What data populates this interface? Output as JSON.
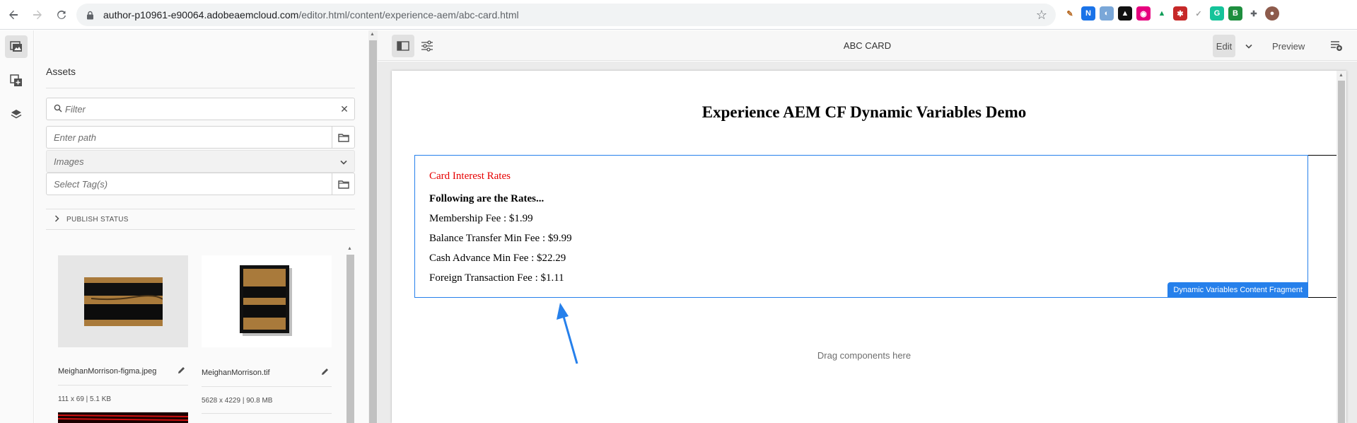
{
  "browser": {
    "url_host": "author-p10961-e90064.adobeaemcloud.com",
    "url_path": "/editor.html/content/experience-aem/abc-card.html",
    "extensions": [
      {
        "name": "pen-extension-icon",
        "bg": "#ffffff",
        "fg": "#b5651d",
        "glyph": "✎"
      },
      {
        "name": "n-extension-icon",
        "bg": "#1a73e8",
        "fg": "#ffffff",
        "glyph": "N"
      },
      {
        "name": "circle-extension-icon",
        "bg": "#7aa7d8",
        "fg": "#ffffff",
        "glyph": "◐"
      },
      {
        "name": "hat-extension-icon",
        "bg": "#111111",
        "fg": "#ffffff",
        "glyph": "▲"
      },
      {
        "name": "cbs-extension-icon",
        "bg": "#e6007e",
        "fg": "#ffffff",
        "glyph": "◉"
      },
      {
        "name": "drive-extension-icon",
        "bg": "#ffffff",
        "fg": "#0f9d58",
        "glyph": "▲"
      },
      {
        "name": "red-extension-icon",
        "bg": "#c62828",
        "fg": "#ffffff",
        "glyph": "✱"
      },
      {
        "name": "check-extension-icon",
        "bg": "#ffffff",
        "fg": "#9e9e9e",
        "glyph": "✓"
      },
      {
        "name": "grammarly-extension-icon",
        "bg": "#15c39a",
        "fg": "#ffffff",
        "glyph": "G"
      },
      {
        "name": "green-b-extension-icon",
        "bg": "#1e8e3e",
        "fg": "#ffffff",
        "glyph": "B"
      },
      {
        "name": "puzzle-extension-icon",
        "bg": "#ffffff",
        "fg": "#5f6368",
        "glyph": "✚"
      },
      {
        "name": "profile-avatar-icon",
        "bg": "#8d5b4c",
        "fg": "#ffffff",
        "glyph": "●"
      }
    ]
  },
  "assets_panel": {
    "title": "Assets",
    "filter_placeholder": "Filter",
    "path_placeholder": "Enter path",
    "type_selected": "Images",
    "tags_placeholder": "Select Tag(s)",
    "publish_status": "PUBLISH STATUS",
    "assets": [
      {
        "name": "MeighanMorrison-figma.jpeg",
        "meta": "111 x 69 | 5.1 KB"
      },
      {
        "name": "MeighanMorrison.tif",
        "meta": "5628 x 4229 | 90.8 MB"
      }
    ]
  },
  "editor": {
    "page_title": "ABC CARD",
    "edit_label": "Edit",
    "preview_label": "Preview"
  },
  "page": {
    "heading": "Experience AEM CF Dynamic Variables Demo",
    "fragment": {
      "title": "Card Interest Rates",
      "subtitle": "Following are the Rates...",
      "rates": [
        "Membership Fee : $1.99",
        "Balance Transfer Min Fee : $9.99",
        "Cash Advance Min Fee : $22.29",
        "Foreign Transaction Fee : $1.11"
      ],
      "component_label": "Dynamic Variables Content Fragment"
    },
    "drag_hint": "Drag components here"
  },
  "colors": {
    "accent": "#2680eb",
    "fragment_title": "#e60000"
  }
}
